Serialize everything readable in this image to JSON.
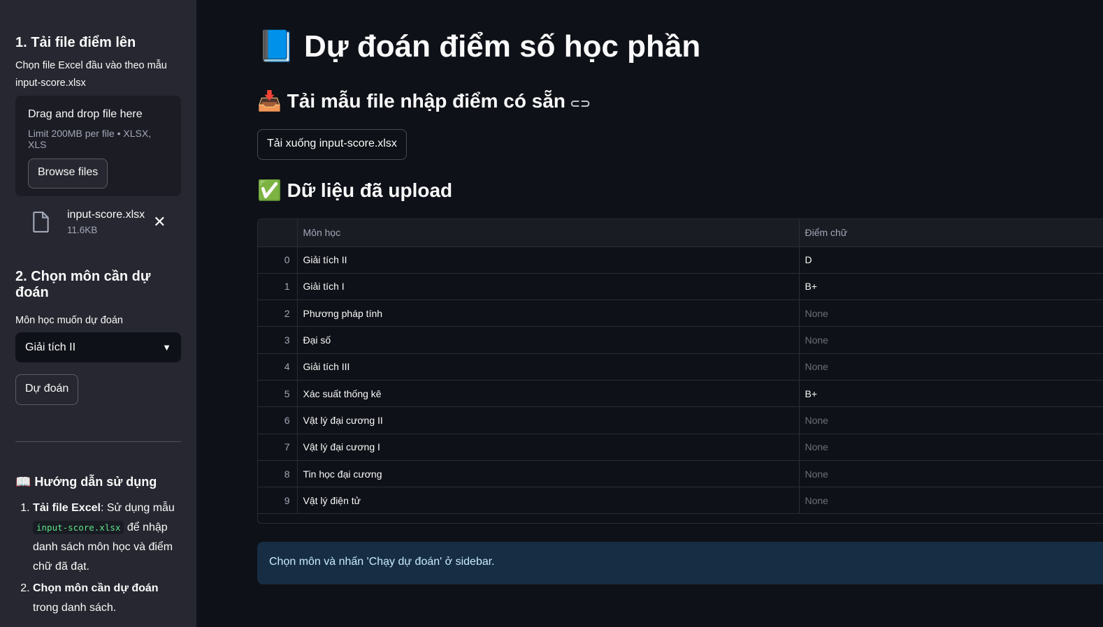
{
  "sidebar": {
    "upload_heading": "1. Tải file điểm lên",
    "upload_label": "Chọn file Excel đầu vào theo mẫu input-score.xlsx",
    "drag_drop": "Drag and drop file here",
    "limit": "Limit 200MB per file • XLSX, XLS",
    "browse_label": "Browse files",
    "file": {
      "name": "input-score.xlsx",
      "size": "11.6KB"
    },
    "choose_heading": "2. Chọn môn cần dự đoán",
    "select_label": "Môn học muốn dự đoán",
    "select_value": "Giải tích II",
    "predict_label": "Dự đoán",
    "guide_heading": "📖 Hướng dẫn sử dụng",
    "guide": [
      {
        "bold": "Tải file Excel",
        "text1": ": Sử dụng mẫu ",
        "code": "input-score.xlsx",
        "text2": " để nhập danh sách môn học và điểm chữ đã đạt."
      },
      {
        "bold": "Chọn môn cần dự đoán",
        "text1": " trong danh sách."
      }
    ]
  },
  "main": {
    "title": "📘 Dự đoán điểm số học phần",
    "template_heading": "📥 Tải mẫu file nhập điểm có sẵn",
    "download_label": "Tải xuống input-score.xlsx",
    "data_heading": "✅ Dữ liệu đã upload",
    "info": "Chọn môn và nhấn 'Chạy dự đoán' ở sidebar."
  },
  "table": {
    "columns": [
      "",
      "Môn học",
      "Điểm chữ"
    ],
    "rows": [
      [
        "0",
        "Giải tích II",
        "D"
      ],
      [
        "1",
        "Giải tích I",
        "B+"
      ],
      [
        "2",
        "Phương pháp tính",
        "None"
      ],
      [
        "3",
        "Đại số",
        "None"
      ],
      [
        "4",
        "Giải tích III",
        "None"
      ],
      [
        "5",
        "Xác suất thống kê",
        "B+"
      ],
      [
        "6",
        "Vật lý đại cương II",
        "None"
      ],
      [
        "7",
        "Vật lý đại cương I",
        "None"
      ],
      [
        "8",
        "Tin học đại cương",
        "None"
      ],
      [
        "9",
        "Vật lý điện tử",
        "None"
      ]
    ]
  },
  "colors": {
    "bg": "#0e1117",
    "sidebar": "#262730",
    "info_bg": "#172d43",
    "code": "#5ce488"
  },
  "icons": {
    "file": "file-icon",
    "close": "close-icon",
    "chevron": "chevron-down-icon",
    "link": "link-icon"
  }
}
